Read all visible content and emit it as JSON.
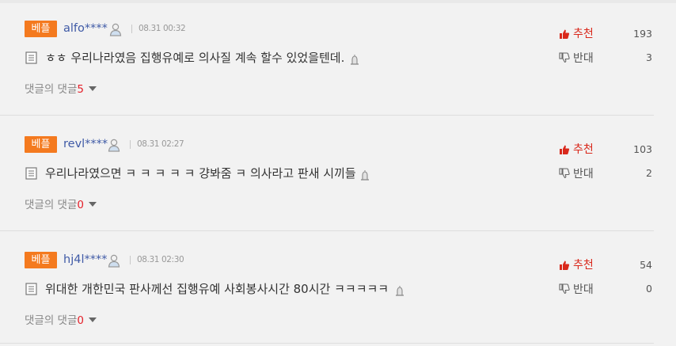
{
  "comments": [
    {
      "badge": "베플",
      "user": "alfo****",
      "date": "08.31 00:32",
      "text": "ㅎㅎ 우리나라였음 집행유예로 의사질 계속 할수 있었을텐데.",
      "recommend_label": "추천",
      "recommend_count": "193",
      "oppose_label": "반대",
      "oppose_count": "3",
      "replies_label": "댓글의 댓글",
      "replies_count": "5"
    },
    {
      "badge": "베플",
      "user": "revl****",
      "date": "08.31 02:27",
      "text": "우리나라였으면 ㅋ ㅋ ㅋ ㅋ ㅋ 걍봐줌 ㅋ 의사라고 판새 시끼들",
      "recommend_label": "추천",
      "recommend_count": "103",
      "oppose_label": "반대",
      "oppose_count": "2",
      "replies_label": "댓글의 댓글",
      "replies_count": "0"
    },
    {
      "badge": "베플",
      "user": "hj4l****",
      "date": "08.31 02:30",
      "text": "위대한 개한민국 판사께선 집행유예 사회봉사시간 80시간 ㅋㅋㅋㅋㅋ",
      "recommend_label": "추천",
      "recommend_count": "54",
      "oppose_label": "반대",
      "oppose_count": "0",
      "replies_label": "댓글의 댓글",
      "replies_count": "0"
    }
  ],
  "icons": {
    "user": "person-icon",
    "document": "document-icon",
    "report": "report-flag-icon",
    "recommend": "thumbs-up-icon",
    "oppose": "thumbs-down-icon",
    "expand": "caret-down-icon"
  },
  "colors": {
    "badge": "#f47a1f",
    "username": "#3f5aa6",
    "recommend": "#d9281b",
    "reply_count": "#e4202a"
  }
}
